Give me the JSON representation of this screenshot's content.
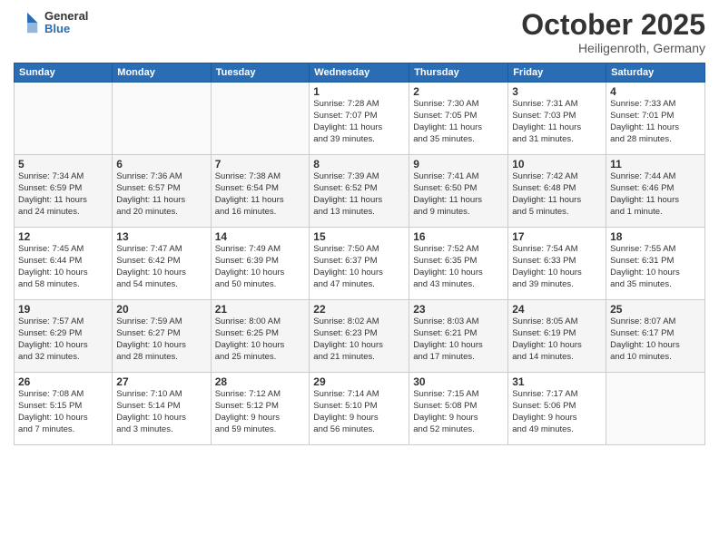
{
  "logo": {
    "general": "General",
    "blue": "Blue"
  },
  "title": "October 2025",
  "subtitle": "Heiligenroth, Germany",
  "days_of_week": [
    "Sunday",
    "Monday",
    "Tuesday",
    "Wednesday",
    "Thursday",
    "Friday",
    "Saturday"
  ],
  "weeks": [
    [
      {
        "day": "",
        "info": ""
      },
      {
        "day": "",
        "info": ""
      },
      {
        "day": "",
        "info": ""
      },
      {
        "day": "1",
        "info": "Sunrise: 7:28 AM\nSunset: 7:07 PM\nDaylight: 11 hours\nand 39 minutes."
      },
      {
        "day": "2",
        "info": "Sunrise: 7:30 AM\nSunset: 7:05 PM\nDaylight: 11 hours\nand 35 minutes."
      },
      {
        "day": "3",
        "info": "Sunrise: 7:31 AM\nSunset: 7:03 PM\nDaylight: 11 hours\nand 31 minutes."
      },
      {
        "day": "4",
        "info": "Sunrise: 7:33 AM\nSunset: 7:01 PM\nDaylight: 11 hours\nand 28 minutes."
      }
    ],
    [
      {
        "day": "5",
        "info": "Sunrise: 7:34 AM\nSunset: 6:59 PM\nDaylight: 11 hours\nand 24 minutes."
      },
      {
        "day": "6",
        "info": "Sunrise: 7:36 AM\nSunset: 6:57 PM\nDaylight: 11 hours\nand 20 minutes."
      },
      {
        "day": "7",
        "info": "Sunrise: 7:38 AM\nSunset: 6:54 PM\nDaylight: 11 hours\nand 16 minutes."
      },
      {
        "day": "8",
        "info": "Sunrise: 7:39 AM\nSunset: 6:52 PM\nDaylight: 11 hours\nand 13 minutes."
      },
      {
        "day": "9",
        "info": "Sunrise: 7:41 AM\nSunset: 6:50 PM\nDaylight: 11 hours\nand 9 minutes."
      },
      {
        "day": "10",
        "info": "Sunrise: 7:42 AM\nSunset: 6:48 PM\nDaylight: 11 hours\nand 5 minutes."
      },
      {
        "day": "11",
        "info": "Sunrise: 7:44 AM\nSunset: 6:46 PM\nDaylight: 11 hours\nand 1 minute."
      }
    ],
    [
      {
        "day": "12",
        "info": "Sunrise: 7:45 AM\nSunset: 6:44 PM\nDaylight: 10 hours\nand 58 minutes."
      },
      {
        "day": "13",
        "info": "Sunrise: 7:47 AM\nSunset: 6:42 PM\nDaylight: 10 hours\nand 54 minutes."
      },
      {
        "day": "14",
        "info": "Sunrise: 7:49 AM\nSunset: 6:39 PM\nDaylight: 10 hours\nand 50 minutes."
      },
      {
        "day": "15",
        "info": "Sunrise: 7:50 AM\nSunset: 6:37 PM\nDaylight: 10 hours\nand 47 minutes."
      },
      {
        "day": "16",
        "info": "Sunrise: 7:52 AM\nSunset: 6:35 PM\nDaylight: 10 hours\nand 43 minutes."
      },
      {
        "day": "17",
        "info": "Sunrise: 7:54 AM\nSunset: 6:33 PM\nDaylight: 10 hours\nand 39 minutes."
      },
      {
        "day": "18",
        "info": "Sunrise: 7:55 AM\nSunset: 6:31 PM\nDaylight: 10 hours\nand 35 minutes."
      }
    ],
    [
      {
        "day": "19",
        "info": "Sunrise: 7:57 AM\nSunset: 6:29 PM\nDaylight: 10 hours\nand 32 minutes."
      },
      {
        "day": "20",
        "info": "Sunrise: 7:59 AM\nSunset: 6:27 PM\nDaylight: 10 hours\nand 28 minutes."
      },
      {
        "day": "21",
        "info": "Sunrise: 8:00 AM\nSunset: 6:25 PM\nDaylight: 10 hours\nand 25 minutes."
      },
      {
        "day": "22",
        "info": "Sunrise: 8:02 AM\nSunset: 6:23 PM\nDaylight: 10 hours\nand 21 minutes."
      },
      {
        "day": "23",
        "info": "Sunrise: 8:03 AM\nSunset: 6:21 PM\nDaylight: 10 hours\nand 17 minutes."
      },
      {
        "day": "24",
        "info": "Sunrise: 8:05 AM\nSunset: 6:19 PM\nDaylight: 10 hours\nand 14 minutes."
      },
      {
        "day": "25",
        "info": "Sunrise: 8:07 AM\nSunset: 6:17 PM\nDaylight: 10 hours\nand 10 minutes."
      }
    ],
    [
      {
        "day": "26",
        "info": "Sunrise: 7:08 AM\nSunset: 5:15 PM\nDaylight: 10 hours\nand 7 minutes."
      },
      {
        "day": "27",
        "info": "Sunrise: 7:10 AM\nSunset: 5:14 PM\nDaylight: 10 hours\nand 3 minutes."
      },
      {
        "day": "28",
        "info": "Sunrise: 7:12 AM\nSunset: 5:12 PM\nDaylight: 9 hours\nand 59 minutes."
      },
      {
        "day": "29",
        "info": "Sunrise: 7:14 AM\nSunset: 5:10 PM\nDaylight: 9 hours\nand 56 minutes."
      },
      {
        "day": "30",
        "info": "Sunrise: 7:15 AM\nSunset: 5:08 PM\nDaylight: 9 hours\nand 52 minutes."
      },
      {
        "day": "31",
        "info": "Sunrise: 7:17 AM\nSunset: 5:06 PM\nDaylight: 9 hours\nand 49 minutes."
      },
      {
        "day": "",
        "info": ""
      }
    ]
  ]
}
